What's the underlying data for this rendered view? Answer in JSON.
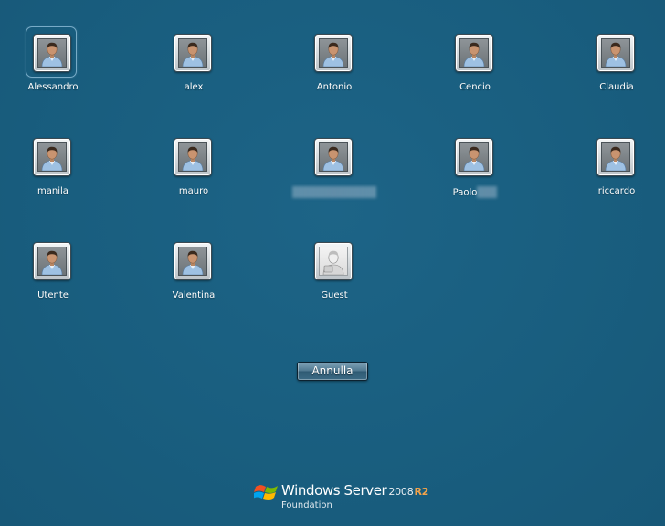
{
  "users": [
    {
      "name": "Alessandro",
      "icon": "user-avatar-icon",
      "selected": true
    },
    {
      "name": "alex",
      "icon": "user-avatar-icon"
    },
    {
      "name": "Antonio",
      "icon": "user-avatar-icon"
    },
    {
      "name": "Cencio",
      "icon": "user-avatar-icon"
    },
    {
      "name": "Claudia",
      "icon": "user-avatar-icon"
    },
    {
      "name": "manila",
      "icon": "user-avatar-icon"
    },
    {
      "name": "mauro",
      "icon": "user-avatar-icon"
    },
    {
      "name": "",
      "icon": "user-avatar-icon",
      "redacted": true
    },
    {
      "name": "Paolo",
      "icon": "user-avatar-icon",
      "partially_redacted": true
    },
    {
      "name": "riccardo",
      "icon": "user-avatar-icon"
    },
    {
      "name": "Utente",
      "icon": "user-avatar-icon"
    },
    {
      "name": "Valentina",
      "icon": "user-avatar-icon"
    },
    {
      "name": "Guest",
      "icon": "guest-avatar-icon"
    }
  ],
  "cancel_button": {
    "label": "Annulla"
  },
  "brand": {
    "name": "Windows Server",
    "version": "2008",
    "release": "R2",
    "edition": "Foundation",
    "icon": "windows-flag-icon"
  },
  "colors": {
    "background": "#195e7f",
    "text": "#ffffff",
    "accent_r2": "#f3a34a"
  }
}
